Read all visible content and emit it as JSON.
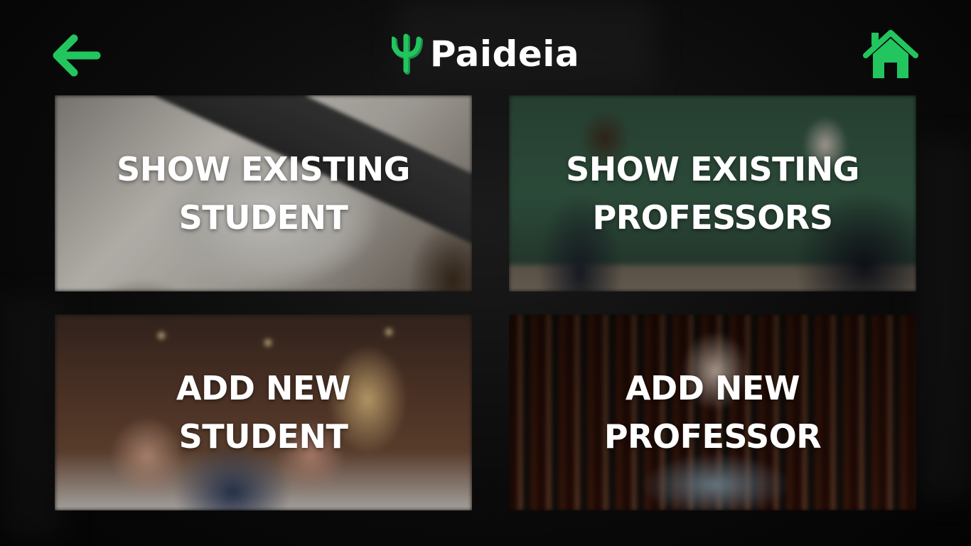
{
  "app": {
    "name": "Paideia"
  },
  "colors": {
    "accent": "#22c55e",
    "text": "#ffffff",
    "background": "#050505"
  },
  "icons": {
    "back": "arrow-left-icon",
    "home": "home-icon",
    "logo": "psi-logo-icon"
  },
  "cards": [
    {
      "line1": "SHOW EXISTING",
      "line2": "STUDENT"
    },
    {
      "line1": "SHOW EXISTING",
      "line2": "PROFESSORS"
    },
    {
      "line1": "ADD NEW",
      "line2": "STUDENT"
    },
    {
      "line1": "ADD NEW",
      "line2": "PROFESSOR"
    }
  ]
}
